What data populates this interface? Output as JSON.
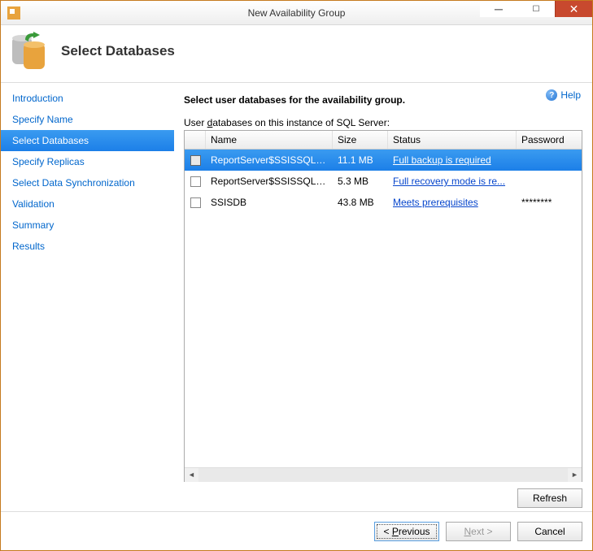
{
  "window": {
    "title": "New Availability Group"
  },
  "header": {
    "title": "Select Databases"
  },
  "help": {
    "label": "Help"
  },
  "sidebar": {
    "items": [
      {
        "label": "Introduction"
      },
      {
        "label": "Specify Name"
      },
      {
        "label": "Select Databases"
      },
      {
        "label": "Specify Replicas"
      },
      {
        "label": "Select Data Synchronization"
      },
      {
        "label": "Validation"
      },
      {
        "label": "Summary"
      },
      {
        "label": "Results"
      }
    ],
    "selected_index": 2
  },
  "main": {
    "instruction": "Select user databases for the availability group.",
    "list_label_pre": "User ",
    "list_label_u": "d",
    "list_label_post": "atabases on this instance of SQL Server:",
    "columns": {
      "name": "Name",
      "size": "Size",
      "status": "Status",
      "password": "Password"
    },
    "rows": [
      {
        "name": "ReportServer$SSISSQLSER...",
        "size": "11.1 MB",
        "status": "Full backup is required",
        "password": "",
        "selected": true
      },
      {
        "name": "ReportServer$SSISSQLSER...",
        "size": "5.3 MB",
        "status": "Full recovery mode is re...",
        "password": "",
        "selected": false
      },
      {
        "name": "SSISDB",
        "size": "43.8 MB",
        "status": "Meets prerequisites",
        "password": "********",
        "selected": false
      }
    ],
    "refresh_label": "Refresh"
  },
  "footer": {
    "previous_pre": "< ",
    "previous_u": "P",
    "previous_post": "revious",
    "next_u": "N",
    "next_post": "ext >",
    "cancel": "Cancel"
  }
}
